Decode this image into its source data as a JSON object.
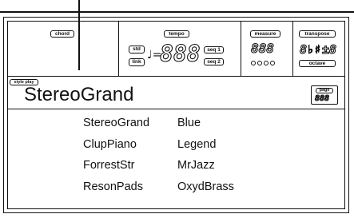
{
  "header": {
    "chord_label": "chord",
    "tempo_label": "tempo",
    "measure_label": "measure",
    "transpose_label": "transpose",
    "octave_label": "octave",
    "std_label": "std",
    "link_label": "link",
    "seq1_label": "seq 1",
    "seq2_label": "seq 2",
    "tempo_value": "888",
    "note_equals": "♩=",
    "measure_value": "888",
    "transpose_value": "±8",
    "transpose_flat": "8♭♯"
  },
  "mode_label": "style play",
  "current_name": "StereoGrand",
  "page_label": "page",
  "page_value": "888",
  "list": {
    "col1": [
      "StereoGrand",
      "ClupPiano",
      "ForrestStr",
      "ResonPads"
    ],
    "col2": [
      "Blue",
      "Legend",
      "MrJazz",
      "OxydBrass"
    ]
  }
}
